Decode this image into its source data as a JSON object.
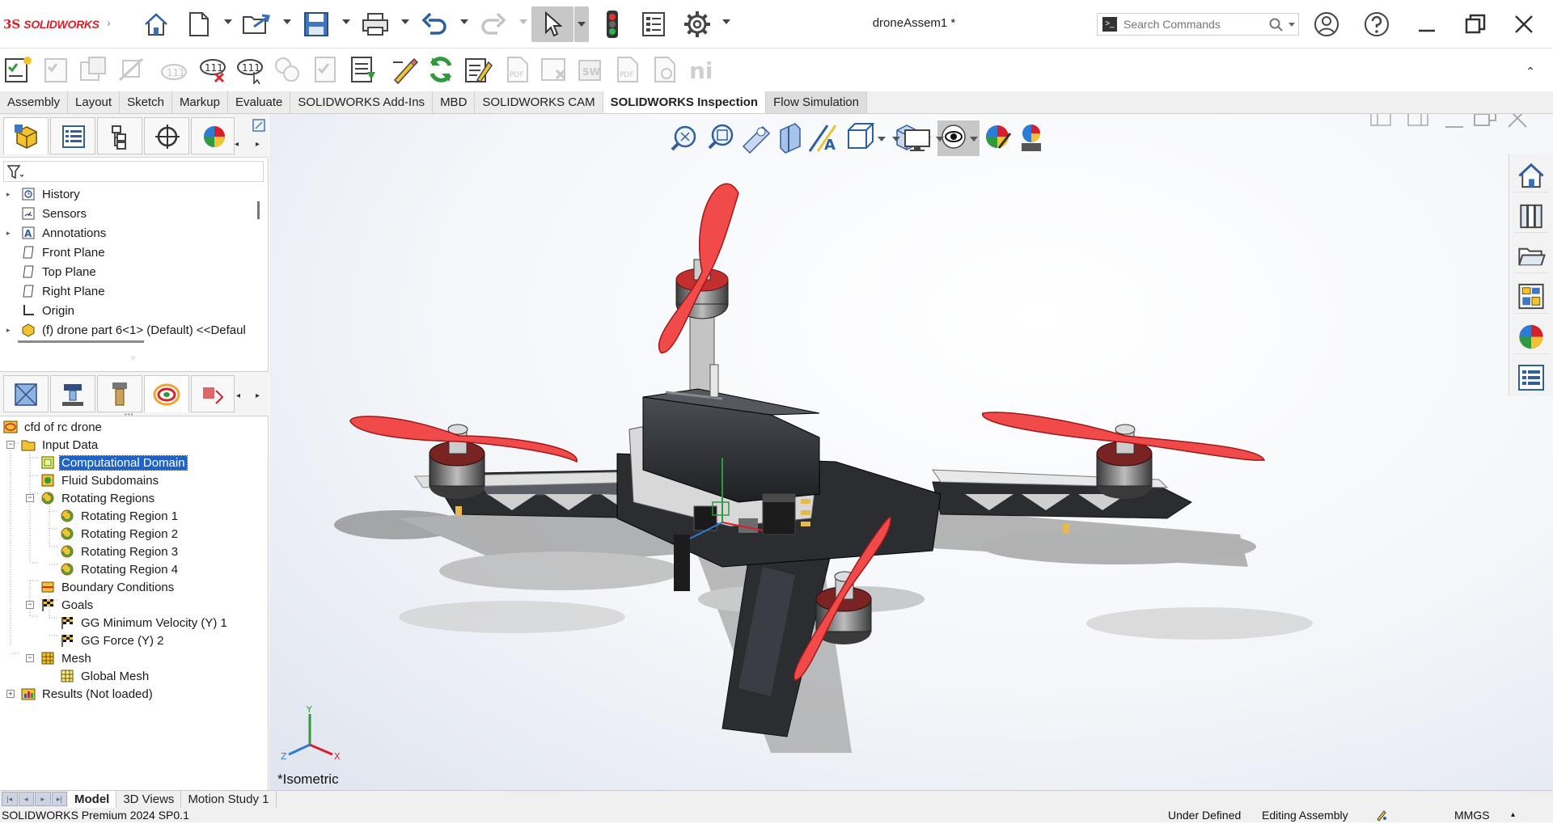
{
  "app": {
    "logo_ds": "3S",
    "logo_text": "SOLIDWORKS",
    "document_title": "droneAssem1 *"
  },
  "search": {
    "placeholder": "Search Commands"
  },
  "tabs": [
    {
      "label": "Assembly"
    },
    {
      "label": "Layout"
    },
    {
      "label": "Sketch"
    },
    {
      "label": "Markup"
    },
    {
      "label": "Evaluate"
    },
    {
      "label": "SOLIDWORKS Add-Ins"
    },
    {
      "label": "MBD"
    },
    {
      "label": "SOLIDWORKS CAM"
    },
    {
      "label": "SOLIDWORKS Inspection"
    },
    {
      "label": "Flow Simulation"
    }
  ],
  "active_tab": "SOLIDWORKS Inspection",
  "feature_tree": {
    "items": [
      {
        "label": "History"
      },
      {
        "label": "Sensors"
      },
      {
        "label": "Annotations"
      },
      {
        "label": "Front Plane"
      },
      {
        "label": "Top Plane"
      },
      {
        "label": "Right Plane"
      },
      {
        "label": "Origin"
      },
      {
        "label": "(f) drone part 6<1> (Default) <<Defaul"
      }
    ]
  },
  "flow_tree": {
    "items": [
      {
        "label": "cfd of rc drone"
      },
      {
        "label": "Input Data"
      },
      {
        "label": "Computational Domain"
      },
      {
        "label": "Fluid Subdomains"
      },
      {
        "label": "Rotating Regions"
      },
      {
        "label": "Rotating Region 1"
      },
      {
        "label": "Rotating Region 2"
      },
      {
        "label": "Rotating Region 3"
      },
      {
        "label": "Rotating Region 4"
      },
      {
        "label": "Boundary Conditions"
      },
      {
        "label": "Goals"
      },
      {
        "label": "GG Minimum Velocity (Y) 1"
      },
      {
        "label": "GG Force (Y) 2"
      },
      {
        "label": "Mesh"
      },
      {
        "label": "Global Mesh"
      },
      {
        "label": "Results (Not loaded)"
      }
    ],
    "selected": "Computational Domain"
  },
  "viewport": {
    "view_label": "*Isometric",
    "triad": {
      "x": "X",
      "y": "Y",
      "z": "Z"
    }
  },
  "bottom_tabs": [
    {
      "label": "Model"
    },
    {
      "label": "3D Views"
    },
    {
      "label": "Motion Study 1"
    }
  ],
  "status": {
    "product": "SOLIDWORKS Premium 2024 SP0.1",
    "definition": "Under Defined",
    "mode": "Editing Assembly",
    "units": "MMGS"
  },
  "colors": {
    "accent_red": "#d6202a",
    "selection_blue": "#1e63c9",
    "propeller_red": "#f04a4a",
    "frame_dark": "#2b2d31"
  }
}
